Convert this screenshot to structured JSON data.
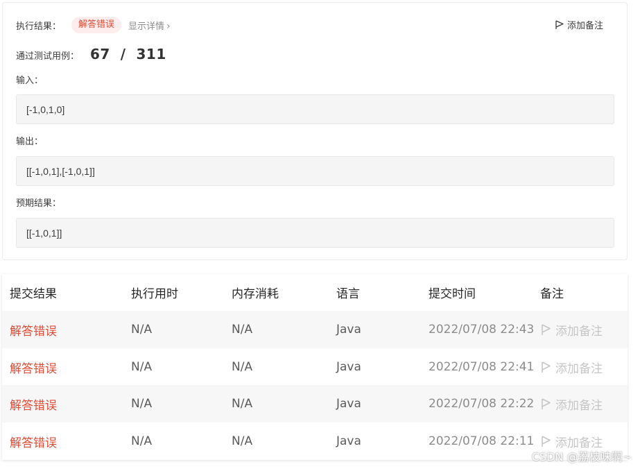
{
  "result": {
    "label": "执行结果：",
    "status_badge": "解答错误",
    "show_details": "显示详情",
    "add_note": "添加备注",
    "passed_label": "通过测试用例：",
    "passed_value": "67  /  311",
    "input_label": "输入：",
    "input_value": "[-1,0,1,0]",
    "output_label": "输出：",
    "output_value": "[[-1,0,1],[-1,0,1]]",
    "expected_label": "预期结果：",
    "expected_value": "[[-1,0,1]]"
  },
  "history": {
    "headers": [
      "提交结果",
      "执行用时",
      "内存消耗",
      "语言",
      "提交时间",
      "备注"
    ],
    "rows": [
      {
        "status": "解答错误",
        "runtime": "N/A",
        "memory": "N/A",
        "lang": "Java",
        "time": "2022/07/08 22:43",
        "note": "添加备注"
      },
      {
        "status": "解答错误",
        "runtime": "N/A",
        "memory": "N/A",
        "lang": "Java",
        "time": "2022/07/08 22:41",
        "note": "添加备注"
      },
      {
        "status": "解答错误",
        "runtime": "N/A",
        "memory": "N/A",
        "lang": "Java",
        "time": "2022/07/08 22:22",
        "note": "添加备注"
      },
      {
        "status": "解答错误",
        "runtime": "N/A",
        "memory": "N/A",
        "lang": "Java",
        "time": "2022/07/08 22:11",
        "note": "添加备注"
      }
    ]
  },
  "watermark": "CSDN @荔枝味啊~",
  "colors": {
    "error": "#e04b36",
    "badge_bg": "#fdeeed",
    "muted": "#8c8c8c"
  }
}
